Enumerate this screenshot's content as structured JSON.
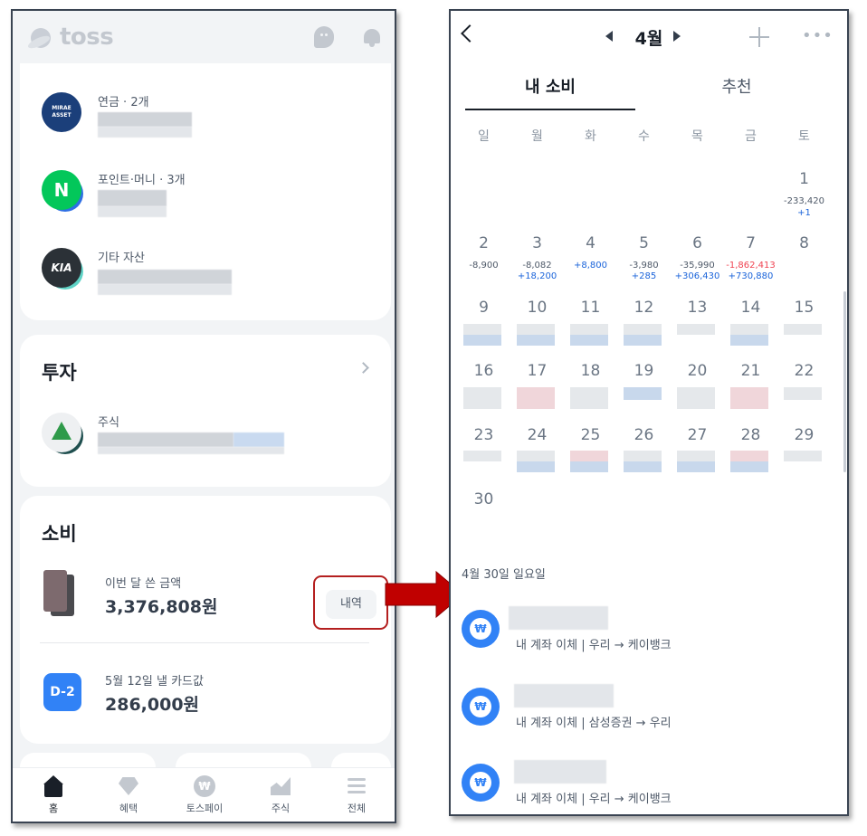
{
  "left": {
    "logo_text": "toss",
    "assets": [
      {
        "label": "연금 · 2개",
        "logo_text": "MIRAE ASSET"
      },
      {
        "label": "포인트·머니 · 3개",
        "logo_text": "N"
      },
      {
        "label": "기타 자산",
        "logo_text": "KIA"
      }
    ],
    "invest": {
      "title": "투자",
      "item_label": "주식"
    },
    "spend": {
      "title": "소비",
      "month_label": "이번 달 쓴 금액",
      "month_amount": "3,376,808원",
      "history_button": "내역",
      "dday": "D-2",
      "due_label": "5월 12일 낼 카드값",
      "due_amount": "286,000원"
    },
    "tabs": [
      "홈",
      "혜택",
      "토스페이",
      "주식",
      "전체"
    ],
    "pay_glyph": "₩"
  },
  "right": {
    "month": "4월",
    "tabs": [
      "내 소비",
      "추천"
    ],
    "weekdays": [
      "일",
      "월",
      "화",
      "수",
      "목",
      "금",
      "토"
    ],
    "week1": {
      "day": "1",
      "neg": "-233,420",
      "pos": "+1"
    },
    "week2": [
      {
        "day": "2",
        "neg": "-8,900",
        "pos": ""
      },
      {
        "day": "3",
        "neg": "-8,082",
        "pos": "+18,200"
      },
      {
        "day": "4",
        "neg": "",
        "pos": "+8,800"
      },
      {
        "day": "5",
        "neg": "-3,980",
        "pos": "+285"
      },
      {
        "day": "6",
        "neg": "-35,990",
        "pos": "+306,430"
      },
      {
        "day": "7",
        "neg": "-1,862,413",
        "pos": "+730,880"
      },
      {
        "day": "8",
        "neg": "",
        "pos": ""
      }
    ],
    "week3": [
      "9",
      "10",
      "11",
      "12",
      "13",
      "14",
      "15"
    ],
    "week4": [
      "16",
      "17",
      "18",
      "19",
      "20",
      "21",
      "22"
    ],
    "week5": [
      "23",
      "24",
      "25",
      "26",
      "27",
      "28",
      "29"
    ],
    "week6": [
      "30"
    ],
    "selected_date": "4월 30일 일요일",
    "transactions": [
      {
        "desc": "내 계좌 이체 | 우리 → 케이뱅크"
      },
      {
        "desc": "내 계좌 이체 | 삼성증권 → 우리"
      },
      {
        "desc": "내 계좌 이체 | 우리 → 케이뱅크"
      }
    ],
    "tx_glyph": "₩"
  },
  "colors": {
    "toss_blue": "#3182f6",
    "highlight_red": "#b41f1f",
    "negative_red": "#f04452",
    "positive_blue": "#1b64da",
    "background_gray": "#f2f4f6"
  }
}
